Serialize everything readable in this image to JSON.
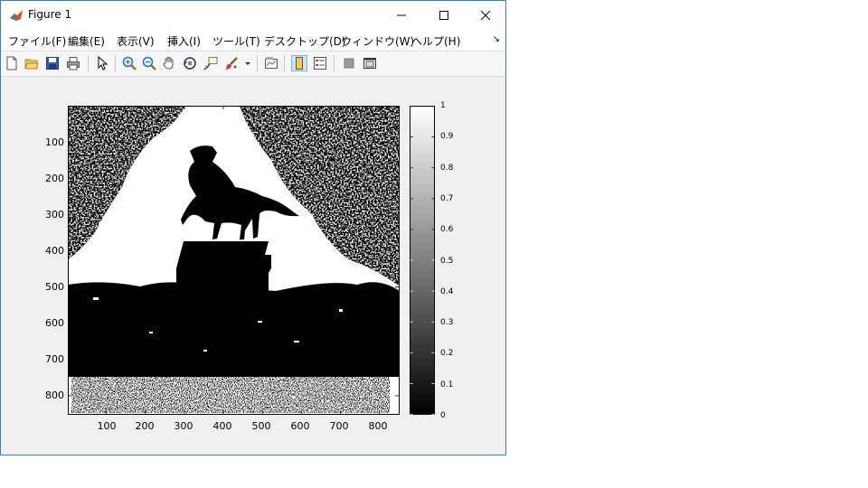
{
  "window": {
    "title": "Figure 1"
  },
  "menu": {
    "items": [
      "ファイル(F)",
      "編集(E)",
      "表示(V)",
      "挿入(I)",
      "ツール(T)",
      "デスクトップ(D)",
      "ウィンドウ(W)",
      "ヘルプ(H)"
    ],
    "overflow_icon": "arrow-down-right-icon"
  },
  "toolbar": {
    "icons": [
      "new-figure-icon",
      "open-file-icon",
      "save-icon",
      "print-icon",
      "select-pointer-icon",
      "zoom-in-icon",
      "zoom-out-icon",
      "pan-hand-icon",
      "rotate-3d-icon",
      "data-cursor-icon",
      "brush-icon",
      "brush-dropdown-icon",
      "link-plot-icon",
      "insert-colorbar-icon",
      "insert-legend-icon",
      "hide-plot-tools-icon",
      "show-plot-tools-icon"
    ]
  },
  "image_axes": {
    "y_ticks": [
      "100",
      "200",
      "300",
      "400",
      "500",
      "600",
      "700",
      "800"
    ],
    "x_ticks": [
      "100",
      "200",
      "300",
      "400",
      "500",
      "600",
      "700",
      "800"
    ],
    "x_range": [
      1,
      850
    ],
    "y_range": [
      1,
      850
    ],
    "content": "binary black-and-white image of an equestrian statue on a pedestal with trees and a sky background"
  },
  "colorbar": {
    "ticks": [
      "1",
      "0.9",
      "0.8",
      "0.7",
      "0.6",
      "0.5",
      "0.4",
      "0.3",
      "0.2",
      "0.1",
      "0"
    ],
    "range": [
      0,
      1
    ],
    "colormap": "gray"
  },
  "colors": {
    "window_border": "#3c7fb1",
    "figure_bg": "#f0f0f0",
    "active_tool": "#cce4f7"
  }
}
